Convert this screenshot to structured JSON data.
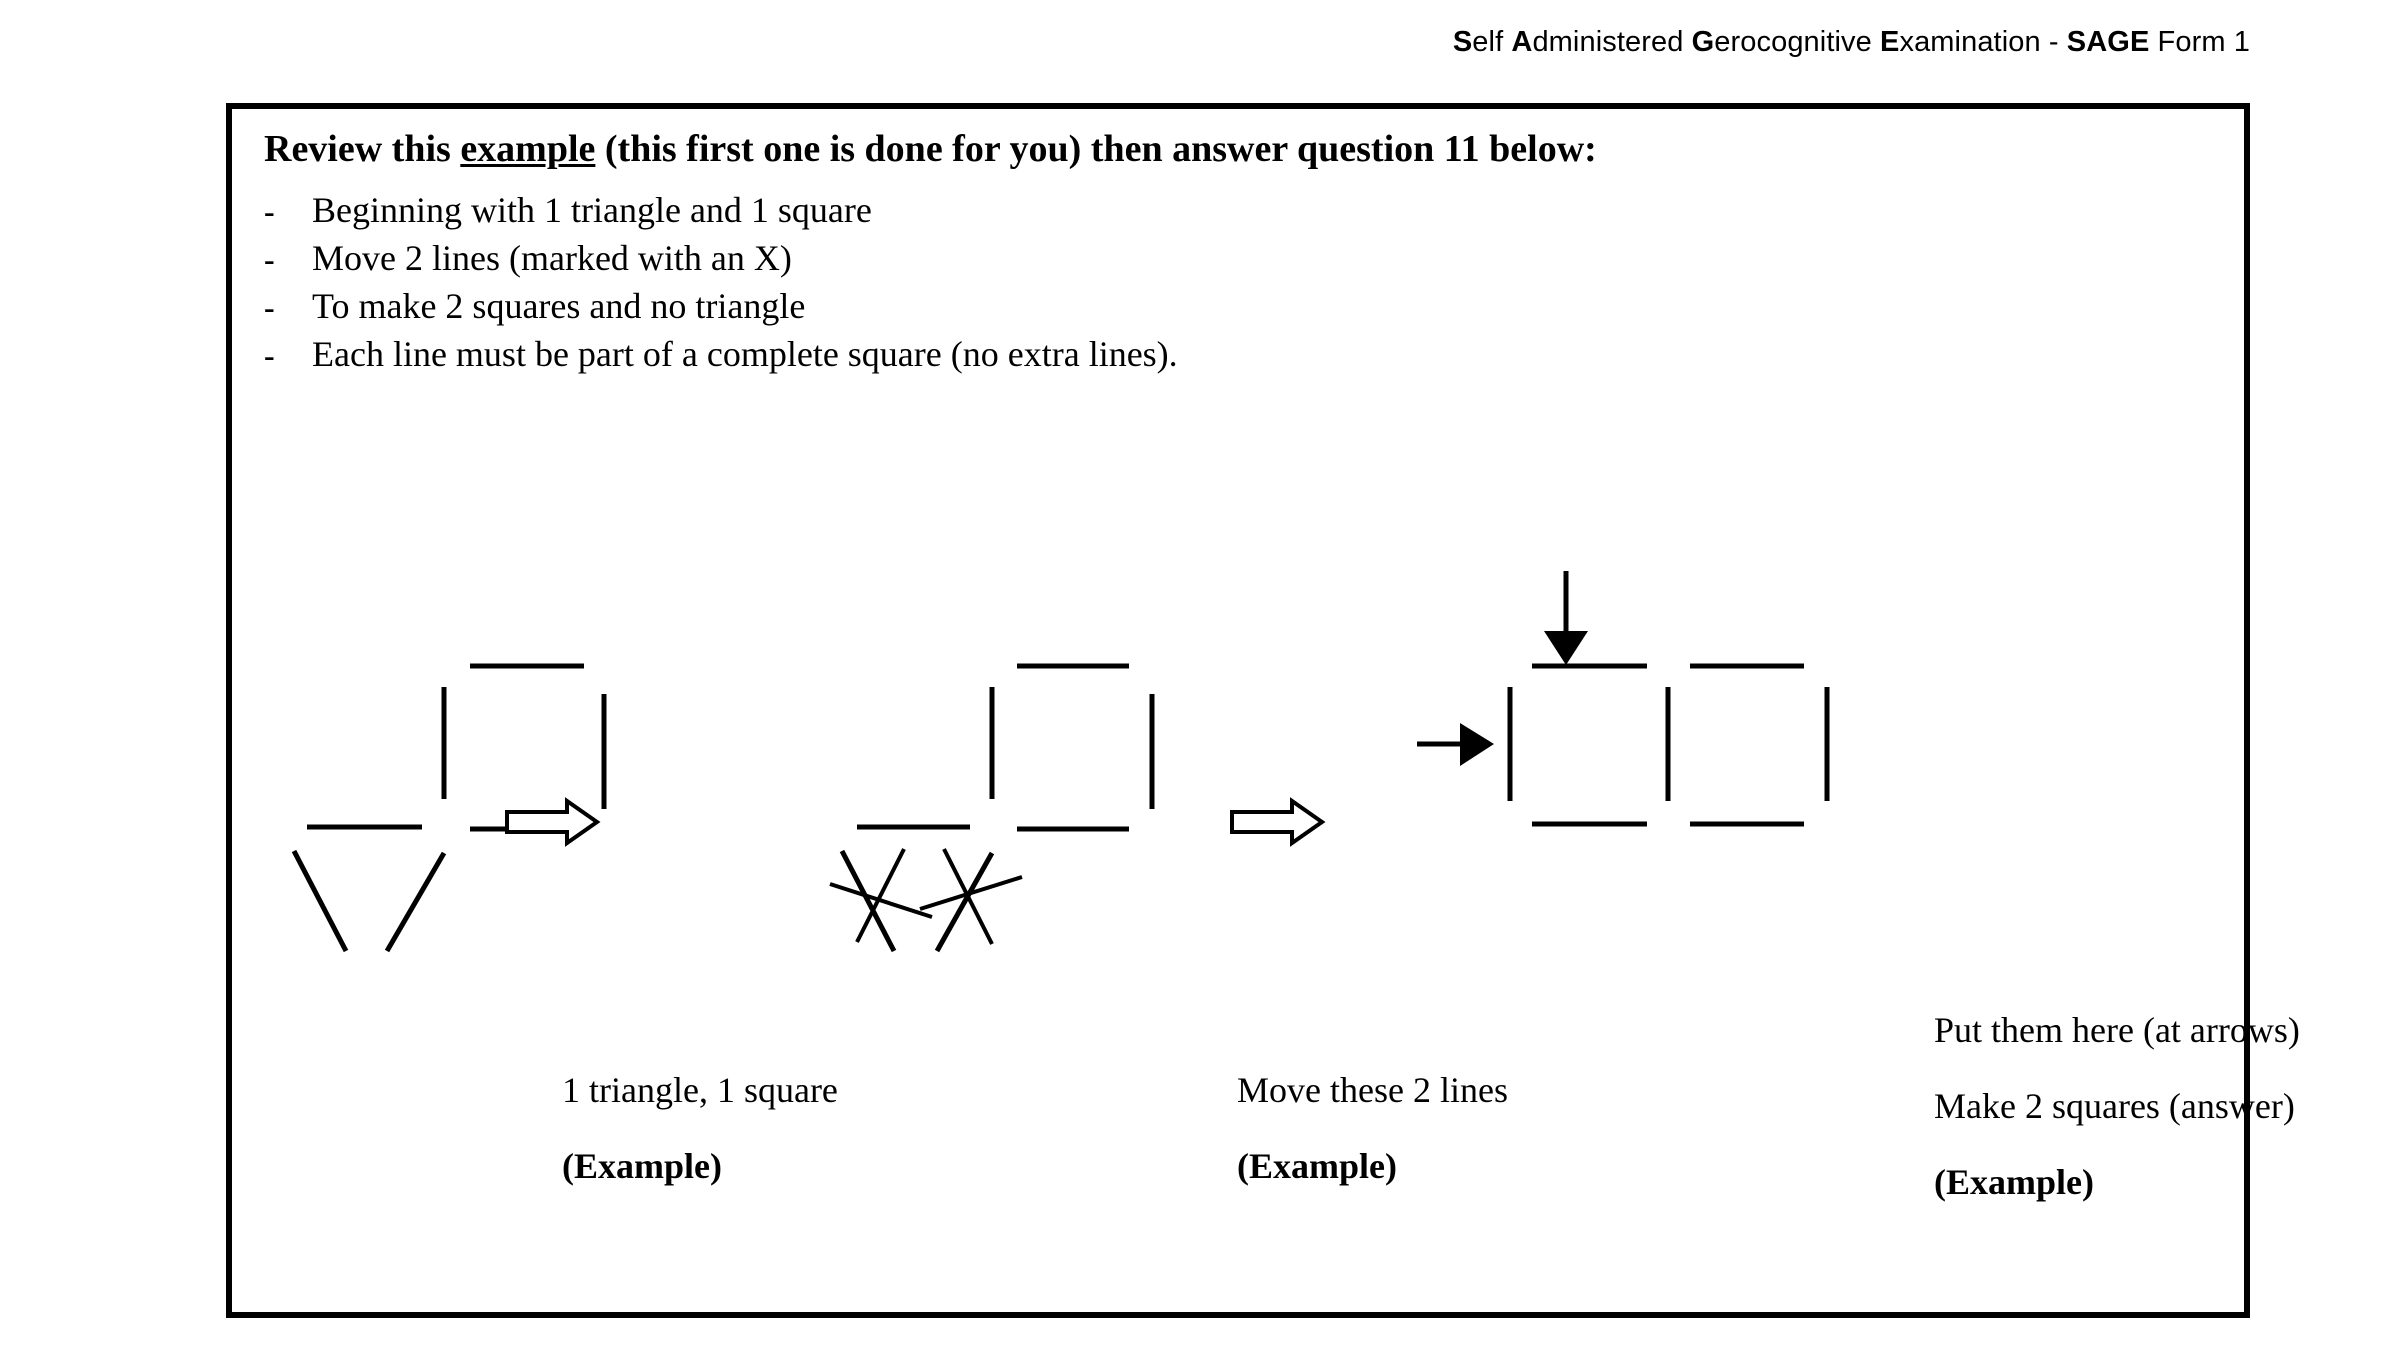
{
  "header": {
    "parts": [
      {
        "text": "S",
        "bold": true
      },
      {
        "text": "elf ",
        "bold": false
      },
      {
        "text": "A",
        "bold": true
      },
      {
        "text": "dministered ",
        "bold": false
      },
      {
        "text": "G",
        "bold": true
      },
      {
        "text": "erocognitive ",
        "bold": false
      },
      {
        "text": "E",
        "bold": true
      },
      {
        "text": "xamination - ",
        "bold": false
      },
      {
        "text": "SAGE",
        "bold": true
      },
      {
        "text": " Form  1",
        "bold": false
      }
    ],
    "full_text": "Self Administered Gerocognitive Examination - SAGE Form  1"
  },
  "instructions": {
    "title_before": "Review this ",
    "title_underlined": "example",
    "title_after": " (this first one is done for you) then answer question 11 below:",
    "bullet_marker": "-",
    "bullets": [
      "Beginning with 1 triangle and 1 square",
      "Move 2 lines (marked with an X)",
      "To make 2 squares and no triangle",
      "Each line must be part of a complete square (no extra lines)."
    ]
  },
  "figures": {
    "stage1": {
      "name": "triangle-and-square",
      "caption": "1 triangle, 1 square",
      "example_label": "(Example)"
    },
    "stage2": {
      "name": "lines-marked-with-x",
      "caption": "Move these 2 lines",
      "example_label": "(Example)"
    },
    "stage3": {
      "name": "two-squares-answer",
      "arrow_note": "Put them here (at arrows)",
      "caption": "Make 2 squares (answer)",
      "example_label": "(Example)"
    },
    "transition_arrow_icon": "hollow-right-arrow",
    "pointer_down_icon": "solid-down-arrow",
    "pointer_right_icon": "solid-right-arrow"
  },
  "colors": {
    "ink": "#000000",
    "paper": "#ffffff",
    "border": "#000000"
  }
}
